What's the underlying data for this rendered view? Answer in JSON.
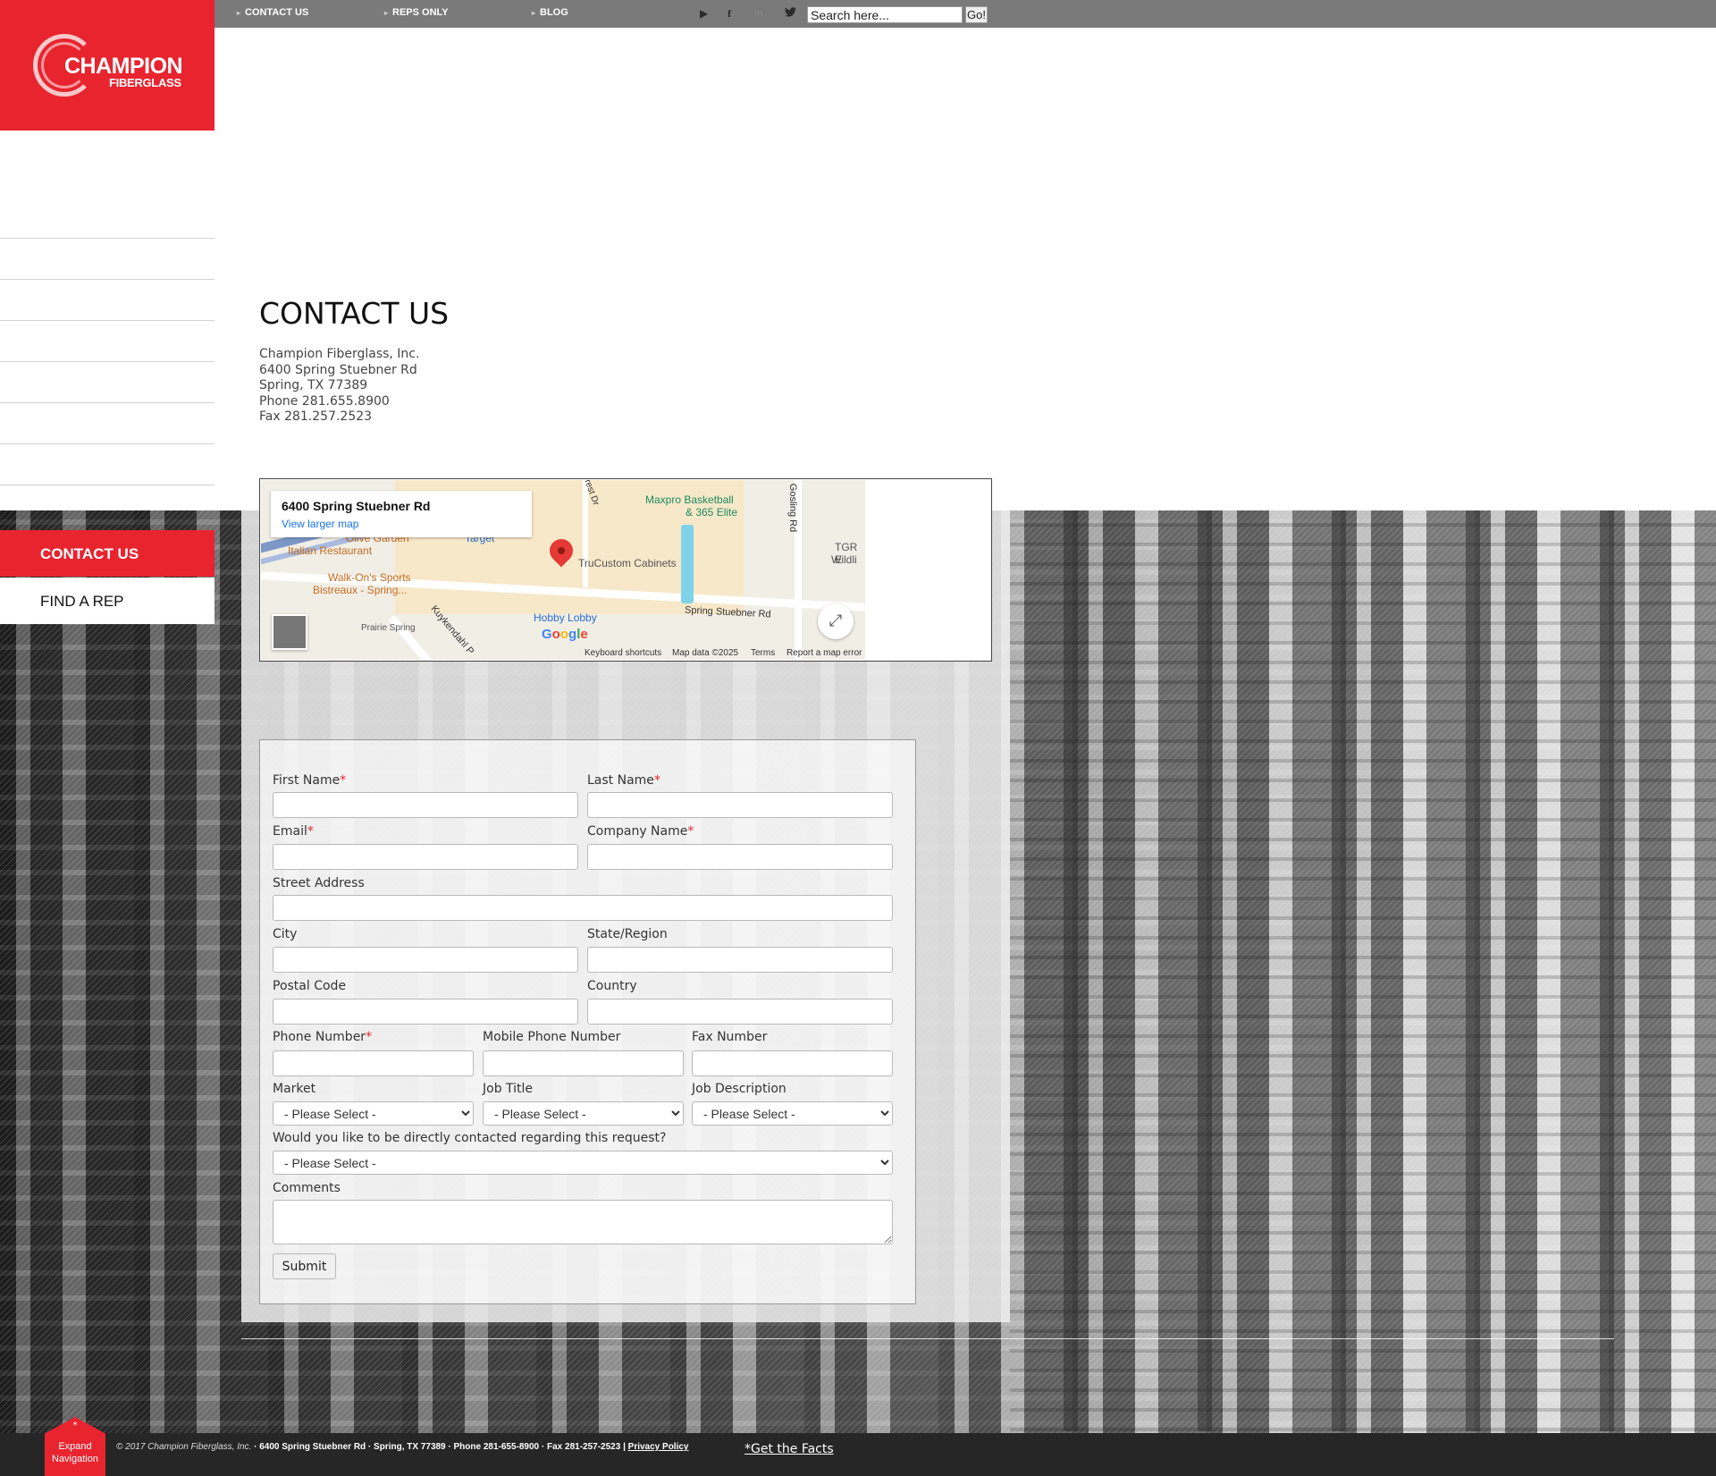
{
  "topbar": {
    "nav": [
      {
        "label": "CONTACT US"
      },
      {
        "label": "REPS ONLY"
      },
      {
        "label": "BLOG"
      }
    ],
    "social": [
      "youtube-icon",
      "facebook-icon",
      "linkedin-icon",
      "twitter-icon"
    ],
    "search": {
      "placeholder": "",
      "value": "Search here...",
      "button": "Go!"
    }
  },
  "logo": {
    "name": "CHAMPION",
    "sub": "FIBERGLASS"
  },
  "sidebar": {
    "items": [
      {
        "label": "CONTACT US",
        "active": true
      },
      {
        "label": "FIND A REP",
        "active": false
      }
    ]
  },
  "main": {
    "title": "CONTACT US",
    "address": {
      "company": "Champion Fiberglass, Inc.",
      "street": "6400 Spring Stuebner Rd",
      "city": "Spring, TX 77389",
      "phone": "Phone 281.655.8900",
      "fax": "Fax 281.257.2523"
    }
  },
  "map": {
    "card_title": "6400 Spring Stuebner Rd",
    "card_link": "View larger map",
    "labels": {
      "maxpro": "Maxpro Basketball",
      "maxpro2": "& 365 Elite",
      "trucustom": "TruCustom Cabinets",
      "walkons": "Walk-On's Sports",
      "walkons2": "Bistreaux - Spring...",
      "olive": "Olive Garden",
      "olive2": "Italian Restaurant",
      "hobby": "Hobby Lobby",
      "target": "Target",
      "tgr": "TGR E",
      "tgr2": "Wildli",
      "spring_rd": "Spring Stuebner Rd",
      "gosling": "Gosling Rd",
      "kuykendahl": "Kuykendahl P",
      "prairie": "Prairie Spring",
      "crest": "Crest Dr"
    },
    "google": "Google",
    "footer": {
      "shortcuts": "Keyboard shortcuts",
      "data": "Map data ©2025",
      "terms": "Terms",
      "report": "Report a map error"
    }
  },
  "form": {
    "first_name": "First Name",
    "last_name": "Last Name",
    "email": "Email",
    "company": "Company Name",
    "street": "Street Address",
    "city": "City",
    "state": "State/Region",
    "postal": "Postal Code",
    "country": "Country",
    "phone": "Phone Number",
    "mobile": "Mobile Phone Number",
    "fax": "Fax Number",
    "market": "Market",
    "job_title": "Job Title",
    "job_desc": "Job Description",
    "contact_q": "Would you like to be directly contacted regarding this request?",
    "comments": "Comments",
    "select_default": "- Please Select -",
    "required_mark": "*",
    "submit": "Submit"
  },
  "footer": {
    "copyright": "© 2017 Champion Fiberglass, Inc.",
    "address": "· 6400 Spring Stuebner Rd · Spring, TX 77389 · Phone 281-655-8900 · Fax 281-257-2523 |",
    "privacy": "Privacy Policy",
    "facts": "*Get the Facts",
    "expand_line1": "Expand",
    "expand_line2": "Navigation",
    "expand_star": "*"
  },
  "colors": {
    "brand_red": "#e8242f",
    "topbar_gray": "#7a7a7a",
    "footer_dark": "#262626"
  }
}
